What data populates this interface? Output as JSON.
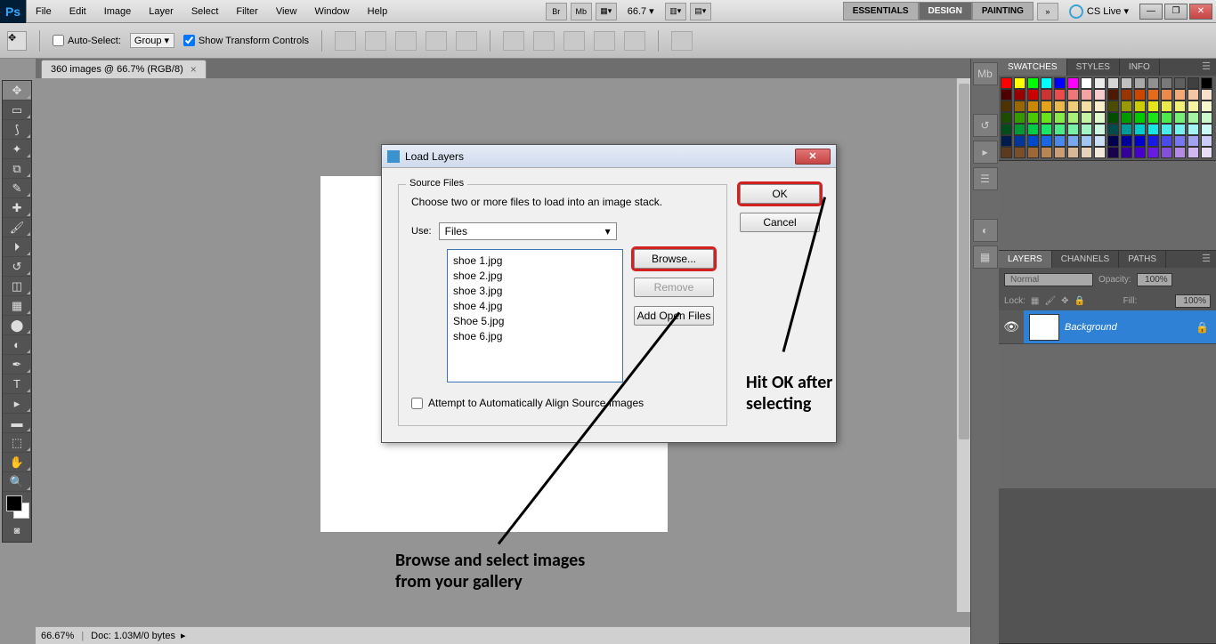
{
  "menu": {
    "items": [
      "File",
      "Edit",
      "Image",
      "Layer",
      "Select",
      "Filter",
      "View",
      "Window",
      "Help"
    ]
  },
  "zoom_display": "66.7 ▾",
  "workspace": {
    "tabs": [
      "ESSENTIALS",
      "DESIGN",
      "PAINTING"
    ],
    "active_index": 1,
    "cs_live": "CS Live ▾"
  },
  "options": {
    "auto_select_label": "Auto-Select:",
    "auto_select_mode": "Group",
    "show_transform": "Show Transform Controls"
  },
  "doc_tab": "360 images @ 66.7% (RGB/8)",
  "statusbar": {
    "zoom": "66.67%",
    "doc_info": "Doc: 1.03M/0 bytes"
  },
  "panels": {
    "swatches_tabs": [
      "SWATCHES",
      "STYLES",
      "INFO"
    ],
    "layers_tabs": [
      "LAYERS",
      "CHANNELS",
      "PATHS"
    ],
    "layers": {
      "blend_label": "Normal",
      "opacity_label": "Opacity:",
      "opacity_val": "100%",
      "lock_label": "Lock:",
      "fill_label": "Fill:",
      "fill_val": "100%",
      "rows": [
        {
          "name": "Background"
        }
      ]
    }
  },
  "dialog": {
    "title": "Load Layers",
    "fieldset_label": "Source Files",
    "instructions": "Choose two or more files to load into an image stack.",
    "use_label": "Use:",
    "use_value": "Files",
    "files": [
      "shoe 1.jpg",
      "shoe 2.jpg",
      "shoe 3.jpg",
      "shoe 4.jpg",
      "Shoe 5.jpg",
      "shoe 6.jpg"
    ],
    "buttons": {
      "ok": "OK",
      "cancel": "Cancel",
      "browse": "Browse...",
      "remove": "Remove",
      "add_open": "Add Open Files"
    },
    "auto_align": "Attempt to Automatically Align Source Images"
  },
  "annotations": {
    "ok": "Hit OK after\nselecting",
    "browse": "Browse and select images\nfrom your gallery"
  },
  "swatch_colors": [
    "#ff0000",
    "#ffff00",
    "#00ff00",
    "#00ffff",
    "#0000ff",
    "#ff00ff",
    "#ffffff",
    "#ebebeb",
    "#d6d6d6",
    "#c0c0c0",
    "#a9a9a9",
    "#919191",
    "#797979",
    "#5f5f5f",
    "#404040",
    "#000000",
    "#4c0000",
    "#990000",
    "#cc0000",
    "#cc3333",
    "#ea4c4c",
    "#f07777",
    "#f4a3a3",
    "#f8cccc",
    "#4c1a00",
    "#993500",
    "#cc4600",
    "#e56a1a",
    "#ea8b4c",
    "#f0a977",
    "#f4c6a3",
    "#f8e1cc",
    "#4c3300",
    "#996600",
    "#cc8800",
    "#e5a31a",
    "#eab84c",
    "#f0cc77",
    "#f4dda3",
    "#f8eecc",
    "#4c4c00",
    "#999900",
    "#cccc00",
    "#e5e51a",
    "#eaea4c",
    "#f0f077",
    "#f4f4a3",
    "#f8f8cc",
    "#1b4c00",
    "#369900",
    "#48cc00",
    "#67e51a",
    "#88ea4c",
    "#a8f077",
    "#c5f4a3",
    "#e1f8cc",
    "#004c00",
    "#009900",
    "#00cc00",
    "#1ae51a",
    "#4cea4c",
    "#77f077",
    "#a3f4a3",
    "#ccf8cc",
    "#004c1b",
    "#009936",
    "#00cc48",
    "#1ae567",
    "#4cea88",
    "#77f0a8",
    "#a3f4c5",
    "#ccf8e1",
    "#004c4c",
    "#009999",
    "#00cccc",
    "#1ae5e5",
    "#4ceaea",
    "#77f0f0",
    "#a3f4f4",
    "#ccf8f8",
    "#001b4c",
    "#003699",
    "#0048cc",
    "#1a67e5",
    "#4c88ea",
    "#77a8f0",
    "#a3c5f4",
    "#cce1f8",
    "#00004c",
    "#000099",
    "#0000cc",
    "#1a1ae5",
    "#4c4cea",
    "#7777f0",
    "#a3a3f4",
    "#ccccf8",
    "#5b3a1e",
    "#7a4e28",
    "#9d6838",
    "#b88555",
    "#c99e76",
    "#d9b897",
    "#e8d1ba",
    "#f3e8dc",
    "#1a004c",
    "#350099",
    "#4600cc",
    "#6a1ae5",
    "#8350d7",
    "#b38be3",
    "#d1b8ee",
    "#e8dcf6"
  ]
}
